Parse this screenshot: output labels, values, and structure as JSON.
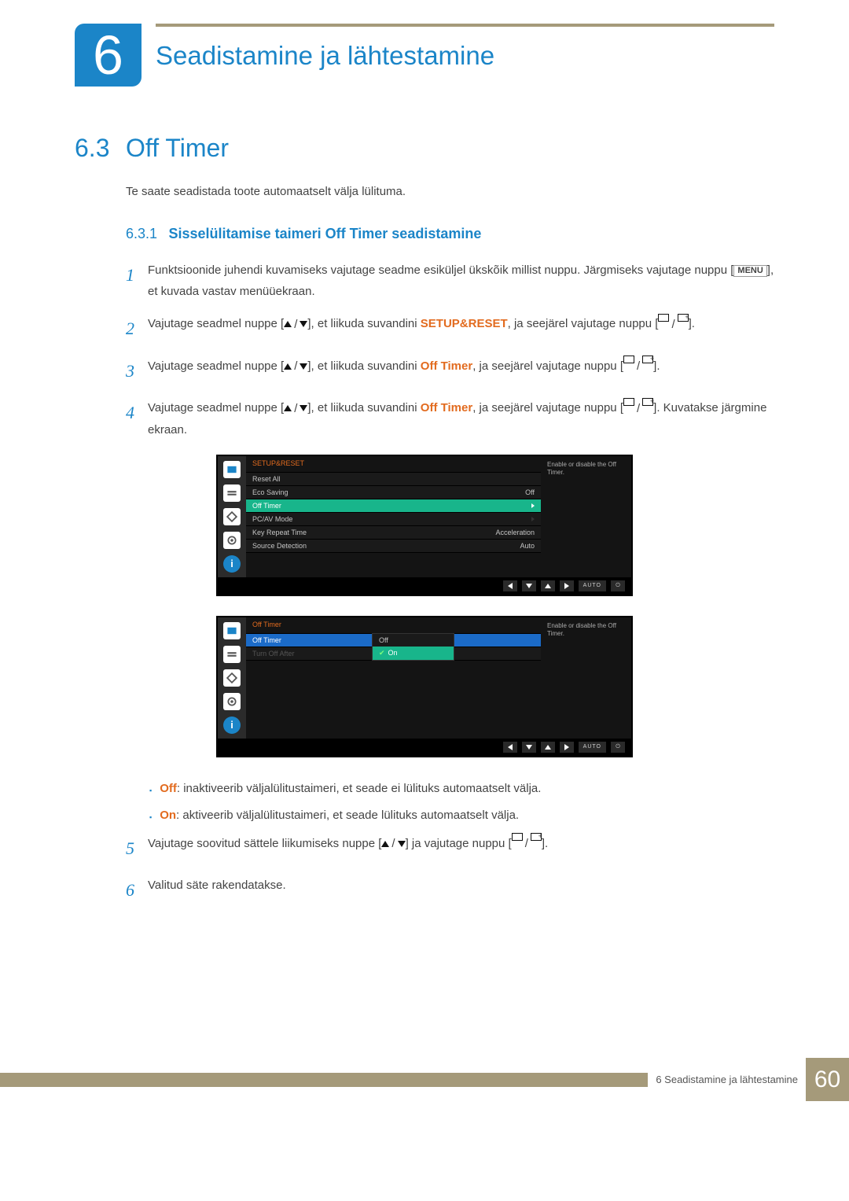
{
  "header": {
    "chapter_number": "6",
    "chapter_title": "Seadistamine ja lähtestamine"
  },
  "section": {
    "number": "6.3",
    "title": "Off Timer",
    "intro": "Te saate seadistada toote automaatselt välja lülituma."
  },
  "subsection": {
    "number": "6.3.1",
    "title": "Sisselülitamise taimeri Off Timer seadistamine"
  },
  "steps": [
    {
      "n": "1",
      "parts": [
        "Funktsioonide juhendi kuvamiseks vajutage seadme esiküljel ükskõik millist nuppu. Järgmiseks vajutage nuppu [",
        {
          "menu": true
        },
        "], et kuvada vastav menüüekraan."
      ]
    },
    {
      "n": "2",
      "parts": [
        "Vajutage seadmel nuppe [",
        {
          "updown": true
        },
        "], et liikuda suvandini ",
        {
          "hl": "SETUP&RESET"
        },
        ", ja seejärel vajutage nuppu [",
        {
          "enter": true
        },
        "]."
      ]
    },
    {
      "n": "3",
      "parts": [
        "Vajutage seadmel nuppe [",
        {
          "updown": true
        },
        "], et liikuda suvandini ",
        {
          "hl": "Off Timer"
        },
        ", ja seejärel vajutage nuppu [",
        {
          "enter": true
        },
        "]."
      ]
    },
    {
      "n": "4",
      "parts": [
        "Vajutage seadmel nuppe [",
        {
          "updown": true
        },
        "], et liikuda suvandini ",
        {
          "hl": "Off Timer"
        },
        ", ja seejärel vajutage nuppu [",
        {
          "enter": true
        },
        "]. Kuvatakse järgmine ekraan."
      ]
    }
  ],
  "osd1": {
    "title": "SETUP&RESET",
    "items": [
      {
        "label": "Reset All",
        "value": ""
      },
      {
        "label": "Eco Saving",
        "value": "Off"
      },
      {
        "label": "Off Timer",
        "value": "",
        "hl": true,
        "arrow": true
      },
      {
        "label": "PC/AV Mode",
        "value": "",
        "arrow": true
      },
      {
        "label": "Key Repeat Time",
        "value": "Acceleration"
      },
      {
        "label": "Source Detection",
        "value": "Auto"
      }
    ],
    "help": "Enable or disable the Off Timer.",
    "nav_auto": "AUTO"
  },
  "osd2": {
    "title": "Off Timer",
    "items": [
      {
        "label": "Off Timer",
        "value": "",
        "blue": true
      },
      {
        "label": "Turn Off After",
        "value": "",
        "dim": true
      }
    ],
    "dropdown": [
      {
        "label": "Off"
      },
      {
        "label": "On",
        "on": true
      }
    ],
    "help": "Enable or disable the Off Timer.",
    "nav_auto": "AUTO"
  },
  "bullets": [
    {
      "hl": "Off",
      "text": ": inaktiveerib väljalülitustaimeri, et seade ei lülituks automaatselt välja."
    },
    {
      "hl": "On",
      "text": ": aktiveerib väljalülitustaimeri, et seade lülituks automaatselt välja."
    }
  ],
  "step5": {
    "n": "5",
    "pre": "Vajutage soovitud sättele liikumiseks nuppe [",
    "mid": "] ja vajutage nuppu [",
    "post": "]."
  },
  "step6": {
    "n": "6",
    "text": "Valitud säte rakendatakse."
  },
  "footer": {
    "text": "6 Seadistamine ja lähtestamine",
    "page": "60"
  }
}
